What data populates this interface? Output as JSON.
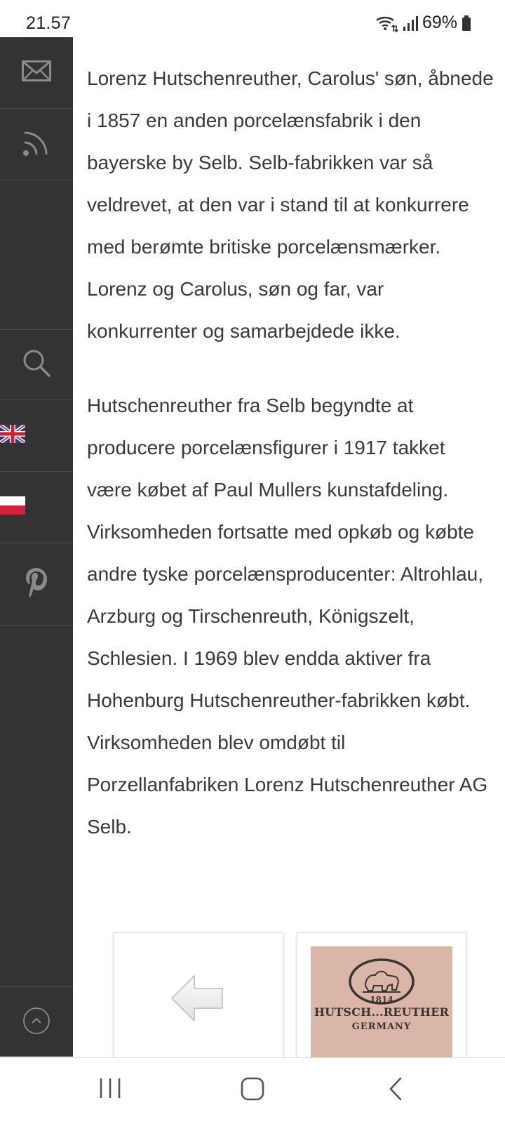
{
  "status_bar": {
    "time": "21.57",
    "battery": "69%"
  },
  "sidebar": {
    "icons": [
      "mail-icon",
      "rss-feed-icon",
      "search-icon",
      "uk-flag-icon",
      "poland-flag-icon",
      "pinterest-icon",
      "scroll-top-icon"
    ]
  },
  "content": {
    "paragraph_1": "Lorenz Hutschenreuther, Carolus' søn, åbnede i 1857 en anden porcelænsfabrik i den bayerske by Selb. Selb-fabrikken var så veldrevet, at den var i stand til at konkurrere med berømte britiske porcelænsmærker. Lorenz og Carolus, søn og far, var konkurrenter og samarbejdede ikke.",
    "paragraph_2": "Hutschenreuther fra Selb begyndte at producere porcelænsfigurer i 1917 takket være købet af Paul Mullers kunstafdeling. Virksomheden fortsatte med opkøb og købte andre tyske porcelænsproducenter: Altrohlau, Arzburg og Tirschenreuth, Königszelt, Schlesien. I 1969 blev endda aktiver fra Hohenburg Hutschenreuther-fabrikken købt. Virksomheden blev omdøbt til Porzellanfabriken Lorenz Hutschenreuther AG Selb."
  },
  "gallery": {
    "mark_year": "1814",
    "mark_brand": "HUTSCH...REUTHER",
    "mark_country": "GERMANY"
  },
  "nav_bar": {
    "icons": [
      "recent-apps-icon",
      "home-icon",
      "back-icon"
    ]
  },
  "colors": {
    "sidebar_bg": "#333333",
    "text": "#3a3a3a",
    "icon_gray": "#8a8a8a",
    "page_bg": "#ffffff"
  }
}
